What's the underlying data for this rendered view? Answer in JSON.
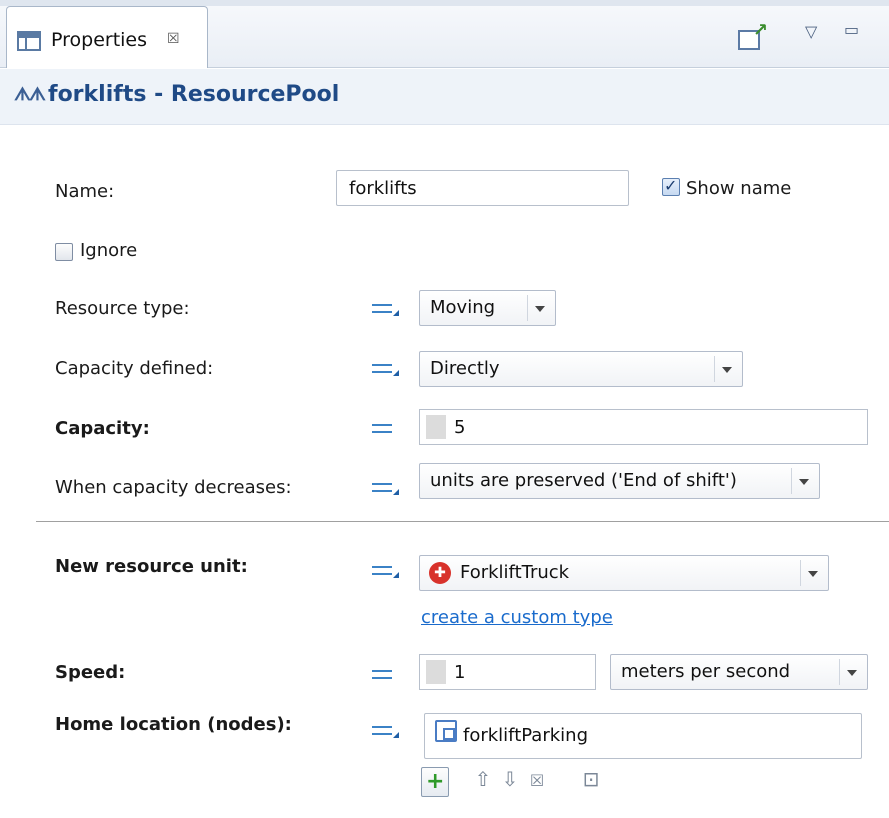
{
  "tab": {
    "label": "Properties",
    "close": "☒"
  },
  "window_controls": {
    "menu": "▽",
    "minimize": "▭"
  },
  "header": {
    "icon": "people-icon",
    "title": "forklifts - ResourcePool"
  },
  "name_row": {
    "label": "Name:",
    "value": "forklifts",
    "show_name_label": "Show name",
    "show_name_checked": true
  },
  "ignore": {
    "label": "Ignore",
    "checked": false
  },
  "resource_type": {
    "label": "Resource type:",
    "value": "Moving"
  },
  "capacity_defined": {
    "label": "Capacity defined:",
    "value": "Directly"
  },
  "capacity": {
    "label": "Capacity:",
    "value": "5"
  },
  "capacity_decreases": {
    "label": "When capacity decreases:",
    "value": "units are preserved ('End of shift')"
  },
  "new_resource_unit": {
    "label": "New resource unit:",
    "value": "ForkliftTruck",
    "link": "create a custom type"
  },
  "speed": {
    "label": "Speed:",
    "value": "1",
    "unit": "meters per second"
  },
  "home_location": {
    "label": "Home location (nodes):",
    "value": "forkliftParking"
  },
  "list_tools": {
    "add": "+",
    "up": "⇧",
    "down": "⇩",
    "remove": "☒",
    "pick": "⊡"
  },
  "colors": {
    "accent": "#1f4a86",
    "link": "#1a6bcc",
    "add_green": "#2f9a2a",
    "agent_red": "#d8322b"
  }
}
